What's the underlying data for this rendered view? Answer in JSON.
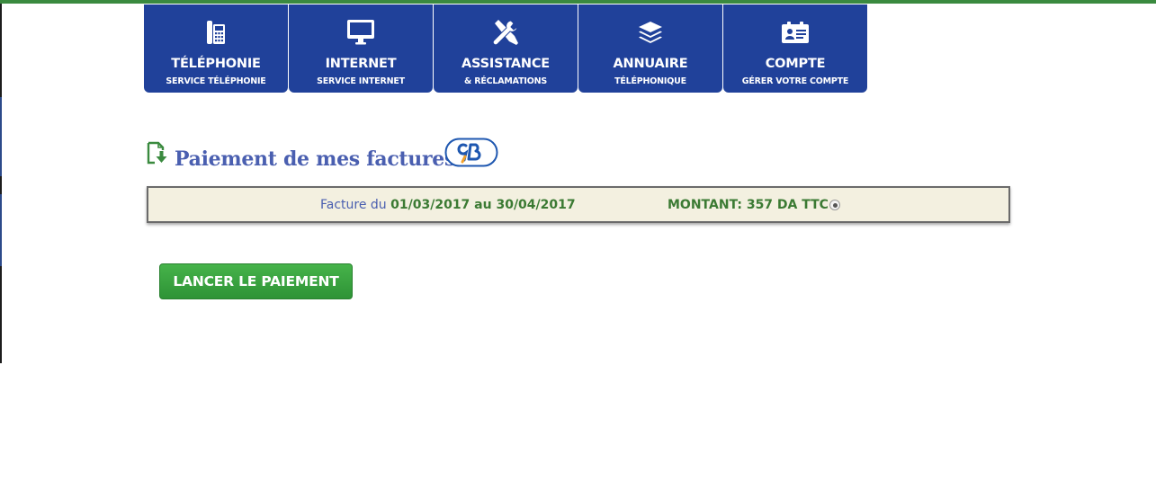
{
  "colors": {
    "top_bar": "#3a8a3f",
    "nav_tile": "#20419a",
    "title": "#4a5fb0",
    "green_text": "#3b7a33",
    "invoice_bg": "#f3f0e0",
    "pay_button": "#3aa33f"
  },
  "nav": {
    "items": [
      {
        "icon": "phone-icon",
        "title": "TÉLÉPHONIE",
        "subtitle": "SERVICE TÉLÉPHONIE"
      },
      {
        "icon": "monitor-icon",
        "title": "INTERNET",
        "subtitle": "SERVICE INTERNET"
      },
      {
        "icon": "tools-icon",
        "title": "ASSISTANCE",
        "subtitle": "& RÉCLAMATIONS"
      },
      {
        "icon": "layers-icon",
        "title": "ANNUAIRE",
        "subtitle": "TÉLÉPHONIQUE"
      },
      {
        "icon": "id-card-icon",
        "title": "COMPTE",
        "subtitle": "GÉRER VOTRE COMPTE"
      }
    ]
  },
  "section": {
    "title": "Paiement de mes factures",
    "icon": "document-download-icon",
    "logo": "cb-card-logo"
  },
  "invoice": {
    "prefix": "Facture du",
    "period": "01/03/2017 au 30/04/2017",
    "amount": "MONTANT: 357 DA TTC",
    "selected": true
  },
  "pay_button": {
    "label": "LANCER LE PAIEMENT"
  }
}
